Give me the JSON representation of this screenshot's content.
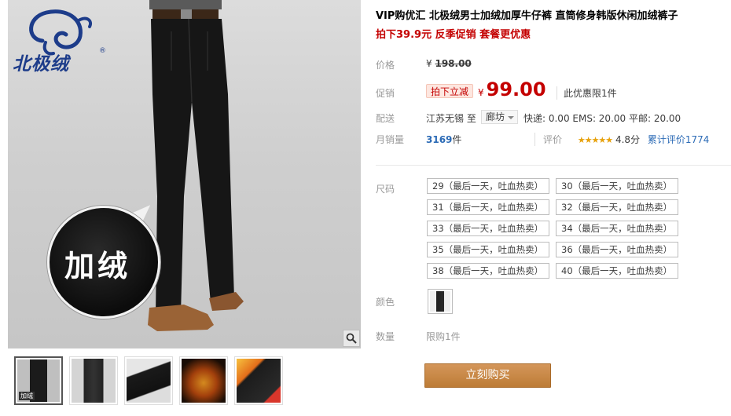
{
  "gallery": {
    "brand_text": "北极绒",
    "reg_mark": "®",
    "feature_badge": "加绒",
    "thumb1_badge": "加绒",
    "zoom_icon": "magnifier-icon"
  },
  "product": {
    "title": "VIP购优汇 北极绒男士加绒加厚牛仔裤 直筒修身韩版休闲加绒裤子",
    "subtitle": "拍下39.9元 反季促销 套餐更优惠"
  },
  "price": {
    "label": "价格",
    "currency": "¥",
    "original": "198.00",
    "promo_label": "促销",
    "promo_tag": "拍下立减",
    "current": "99.00",
    "limit_note": "此优惠限1件"
  },
  "shipping": {
    "label": "配送",
    "from": "江苏无锡",
    "to_word": "至",
    "to_city": "廊坊",
    "fees": "快递: 0.00 EMS: 20.00 平邮: 20.00"
  },
  "sales": {
    "label": "月销量",
    "count": "3169",
    "unit": "件",
    "rating_label": "评价",
    "stars": "★★★★★",
    "score": "4.8分",
    "review_link": "累计评价1774"
  },
  "sizes": {
    "label": "尺码",
    "options": [
      "29（最后一天，吐血热卖）",
      "30（最后一天，吐血热卖）",
      "31（最后一天，吐血热卖）",
      "32（最后一天，吐血热卖）",
      "33（最后一天，吐血热卖）",
      "34（最后一天，吐血热卖）",
      "35（最后一天，吐血热卖）",
      "36（最后一天，吐血热卖）",
      "38（最后一天，吐血热卖）",
      "40（最后一天，吐血热卖）"
    ]
  },
  "color": {
    "label": "颜色"
  },
  "quantity": {
    "label": "数量",
    "value": "限购1件"
  },
  "buy_button": "立刻购买",
  "colors": {
    "price_red": "#c40000",
    "link_blue": "#2c6bb6",
    "buy_orange": "#c98a46",
    "star_gold": "#e7a10b"
  }
}
